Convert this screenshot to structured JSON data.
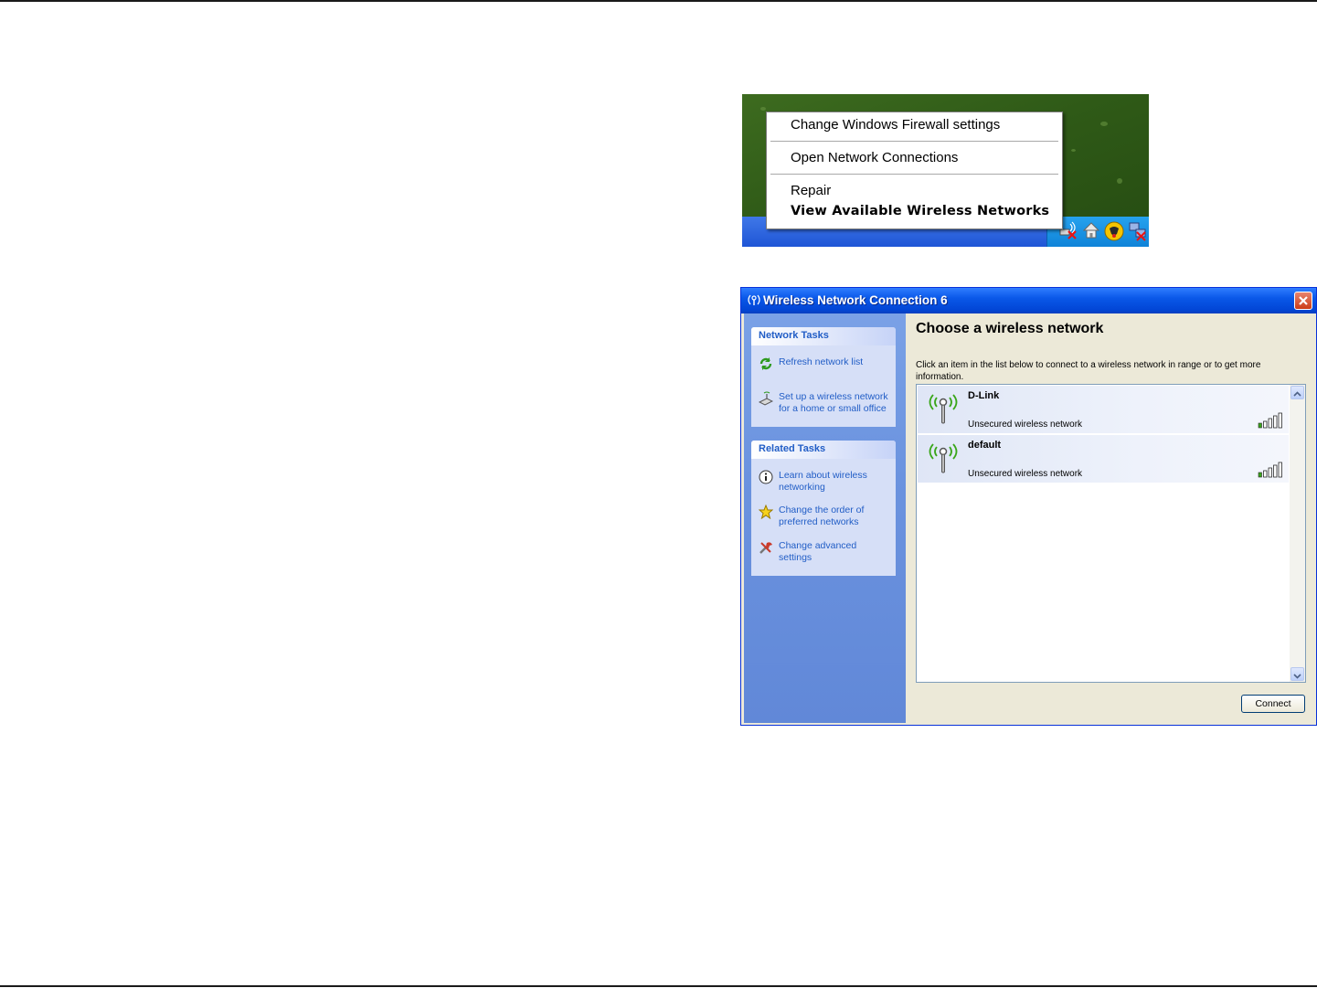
{
  "tray_menu": {
    "items": [
      {
        "label": "Change Windows Firewall settings",
        "bold": false
      },
      {
        "label": "Open Network Connections",
        "bold": false
      },
      {
        "label": "Repair",
        "bold": false
      },
      {
        "label": "View Available Wireless Networks",
        "bold": true
      }
    ],
    "tray_icons": [
      "wireless-disconnected-icon",
      "home-network-icon",
      "security-center-icon",
      "network-disconnected-icon"
    ]
  },
  "dialog": {
    "title": "Wireless Network Connection 6",
    "left_pane": {
      "network_tasks": {
        "header": "Network Tasks",
        "items": [
          {
            "label": "Refresh network list",
            "icon": "refresh-icon"
          },
          {
            "label": "Set up a wireless network for a home or small office",
            "icon": "setup-wireless-icon"
          }
        ]
      },
      "related_tasks": {
        "header": "Related Tasks",
        "items": [
          {
            "label": "Learn about wireless networking",
            "icon": "info-icon"
          },
          {
            "label": "Change the order of preferred networks",
            "icon": "star-icon"
          },
          {
            "label": "Change advanced settings",
            "icon": "tools-icon"
          }
        ]
      }
    },
    "main": {
      "heading": "Choose a wireless network",
      "instructions": "Click an item in the list below to connect to a wireless network in range or to get more information.",
      "networks": [
        {
          "name": "D-Link",
          "status": "Unsecured wireless network",
          "signal_bars": 5
        },
        {
          "name": "default",
          "status": "Unsecured wireless network",
          "signal_bars": 5
        }
      ],
      "connect_label": "Connect"
    }
  },
  "colors": {
    "xp_title_blue": "#0a58e8",
    "task_link_blue": "#215dc6",
    "signal_green": "#3aa619"
  }
}
